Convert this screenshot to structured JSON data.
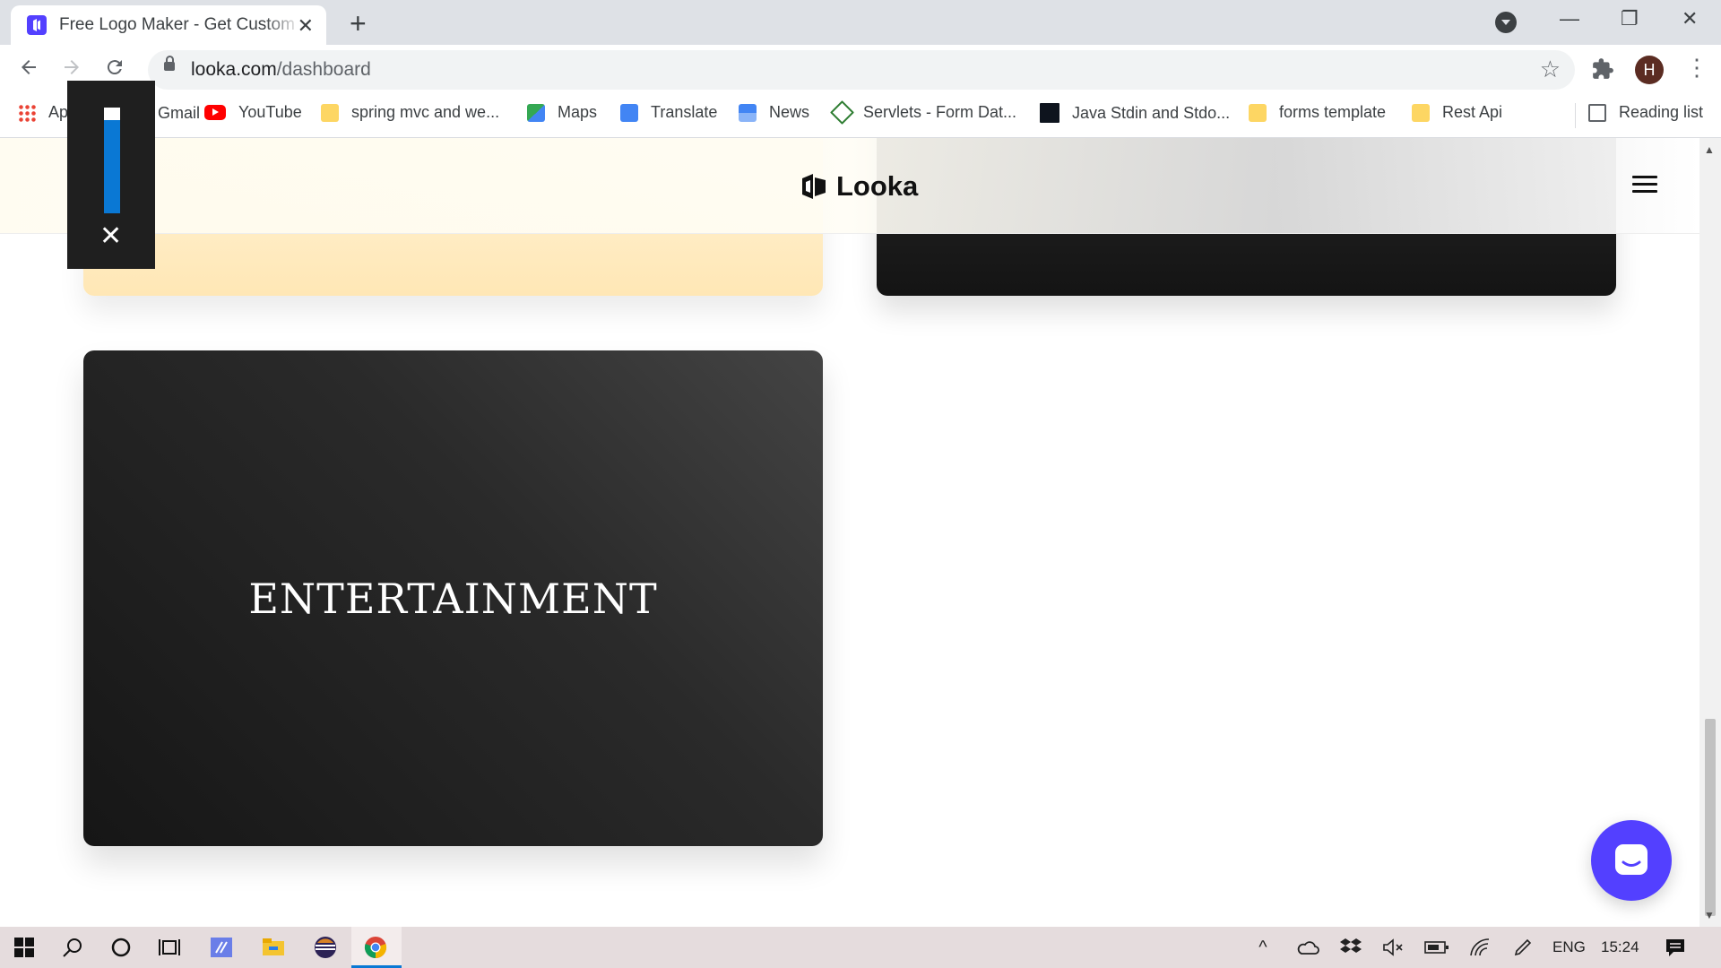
{
  "browser": {
    "tab_title": "Free Logo Maker - Get Custom Logo",
    "new_tab_label": "+",
    "minimize_label": "—",
    "restore_label": "❐",
    "close_label": "✕",
    "url_host": "looka.com",
    "url_path": "/dashboard",
    "profile_initial": "H"
  },
  "bookmarks": [
    {
      "label": "Apps",
      "icon": "apps-grid-icon"
    },
    {
      "label": "Gmail",
      "icon": "gmail-icon"
    },
    {
      "label": "YouTube",
      "icon": "youtube-icon"
    },
    {
      "label": "spring mvc and we...",
      "icon": "folder-icon"
    },
    {
      "label": "Maps",
      "icon": "maps-icon"
    },
    {
      "label": "Translate",
      "icon": "translate-icon"
    },
    {
      "label": "News",
      "icon": "news-icon"
    },
    {
      "label": "Servlets - Form Dat...",
      "icon": "servlets-icon"
    },
    {
      "label": "Java Stdin and Stdo...",
      "icon": "hackerrank-icon"
    },
    {
      "label": "forms template",
      "icon": "folder-icon"
    },
    {
      "label": "Rest Api",
      "icon": "folder-icon"
    }
  ],
  "reading_list": "Reading list",
  "site": {
    "logo_text": "Looka",
    "entertainment_label": "ENTERTAINMENT",
    "brand_color": "#5340ff"
  },
  "volume_overlay": {
    "close_label": "✕",
    "level": 0.93
  },
  "taskbar": {
    "language": "ENG",
    "time": "15:24"
  }
}
